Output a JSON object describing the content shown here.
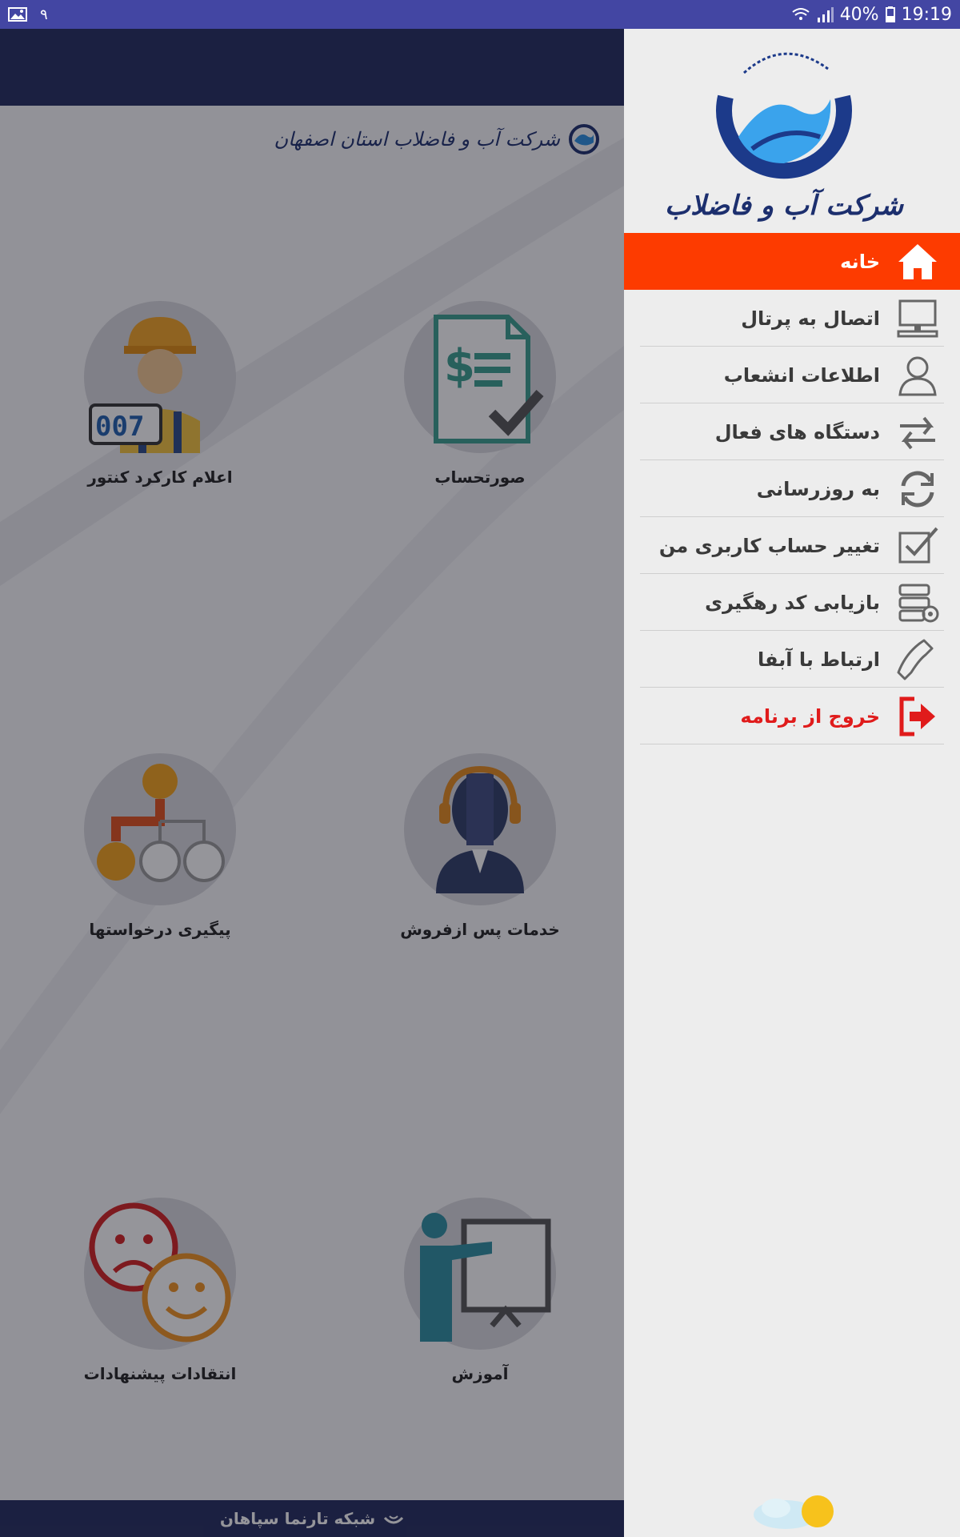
{
  "status_bar": {
    "notification_char": "۹",
    "battery": "40%",
    "time": "19:19"
  },
  "main": {
    "brand_text": "شرکت آب و فاضلاب استان اصفهان",
    "tiles": [
      {
        "label": "صورتحساب",
        "icon": "invoice-icon"
      },
      {
        "label": "اعلام کارکرد کنتور",
        "icon": "meter-worker-icon"
      },
      {
        "label": "خدمات پس ازفروش",
        "icon": "support-agent-icon"
      },
      {
        "label": "پیگیری درخواستها",
        "icon": "request-tracking-icon"
      },
      {
        "label": "آموزش",
        "icon": "training-icon"
      },
      {
        "label": "انتقادات پیشنهادات",
        "icon": "feedback-faces-icon"
      }
    ],
    "footer": "شبکه تارنما سپاهان"
  },
  "drawer": {
    "logo_motto": "و من الماء کل شیء حی",
    "logo_title": "شرکت آب و فاضلاب",
    "menu": [
      {
        "label": "خانه",
        "icon": "home-icon",
        "active": true
      },
      {
        "label": "اتصال به پرتال",
        "icon": "computer-icon"
      },
      {
        "label": "اطلاعات انشعاب",
        "icon": "user-icon"
      },
      {
        "label": "دستگاه های فعال",
        "icon": "transfer-arrows-icon"
      },
      {
        "label": "به روزرسانی",
        "icon": "refresh-icon"
      },
      {
        "label": "تغییر حساب کاربری من",
        "icon": "checkbox-edit-icon"
      },
      {
        "label": "بازیابی کد رهگیری",
        "icon": "server-settings-icon"
      },
      {
        "label": "ارتباط با آبفا",
        "icon": "phone-icon"
      },
      {
        "label": "خروج از برنامه",
        "icon": "exit-icon",
        "exit": true
      }
    ]
  },
  "colors": {
    "status_bar": "#4346a3",
    "appbar": "#222b5e",
    "active_menu": "#fd3b00",
    "exit_red": "#e01b1b"
  }
}
